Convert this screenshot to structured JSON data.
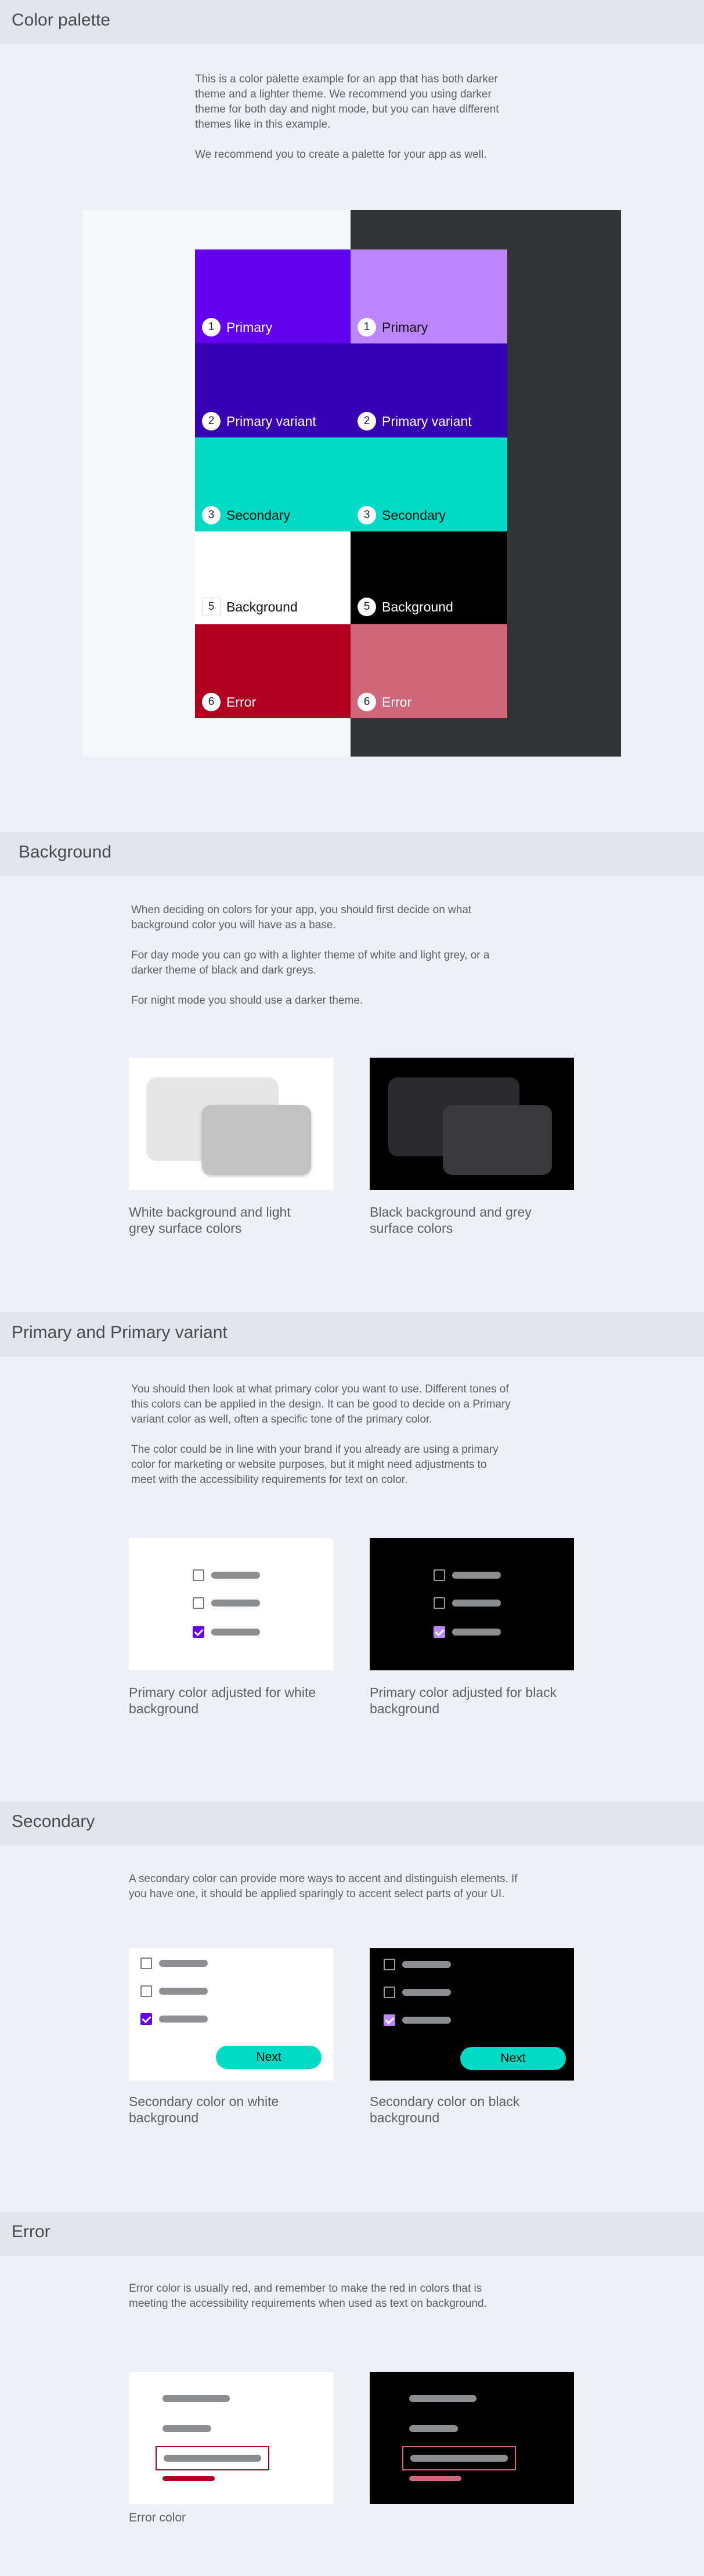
{
  "colors": {
    "primary_day": "#6200ee",
    "primary_night": "#bb86fc",
    "primary_variant": "#3700b3",
    "primary_variant_night": "#3700b3",
    "secondary": "#03dac5",
    "background_day": "#ffffff",
    "background_night": "#000000",
    "error_day": "#b00020",
    "error_night": "#cf6679"
  },
  "palette_section": {
    "title": "Color palette",
    "intro": "This is a color palette example for an app that has both darker\ntheme and a lighter theme. We recommend you using darker\ntheme for both day and night mode, but you can have different\nthemes like in this example.\n\nWe recommend you to create a palette for your app as well.",
    "swatches": [
      {
        "num": "1",
        "label": "Primary"
      },
      {
        "num": "2",
        "label": "Primary variant"
      },
      {
        "num": "3",
        "label": "Secondary"
      },
      {
        "num": "5",
        "label": "Background"
      },
      {
        "num": "6",
        "label": "Error"
      }
    ]
  },
  "background_section": {
    "title": "Background",
    "intro": "When deciding on colors for your app, you should first decide on what\nbackground color you will have as a base.\n\nFor day mode you can go with a lighter theme of white and light grey, or a\ndarker theme of black and dark greys.\n\nFor night mode you should use a darker theme.",
    "caption_white": "White background and light\ngrey surface colors",
    "caption_black": "Black background and grey\nsurface colors"
  },
  "primary_section": {
    "title": "Primary and Primary variant",
    "intro": "You should then look at what primary color you want to use. Different tones of\nthis colors can be applied in the design. It can be good to decide on a Primary\nvariant color as well, often a specific tone of the primary color.\n\nThe color  could be in line with your brand if you already are using a primary\ncolor for marketing or website purposes, but it might need adjustments to\nmeet with the accessibility requirements for text on color.",
    "caption_white": "Primary color adjusted for white\nbackground",
    "caption_black": "Primary color adjusted for black\nbackground"
  },
  "secondary_section": {
    "title": "Secondary",
    "intro": "A secondary color can provide more ways to accent and distinguish elements. If\nyou have one, it should be applied sparingly to accent select parts of your UI.",
    "next_label": "Next",
    "caption_white": "Secondary color on white\nbackground",
    "caption_black": "Secondary color on black\nbackground"
  },
  "error_section": {
    "title": "Error",
    "intro": "Error color is usually red, and remember to make the red in colors that is\nmeeting the accessibility requirements when used as text on background.",
    "caption_white": "Error color"
  }
}
